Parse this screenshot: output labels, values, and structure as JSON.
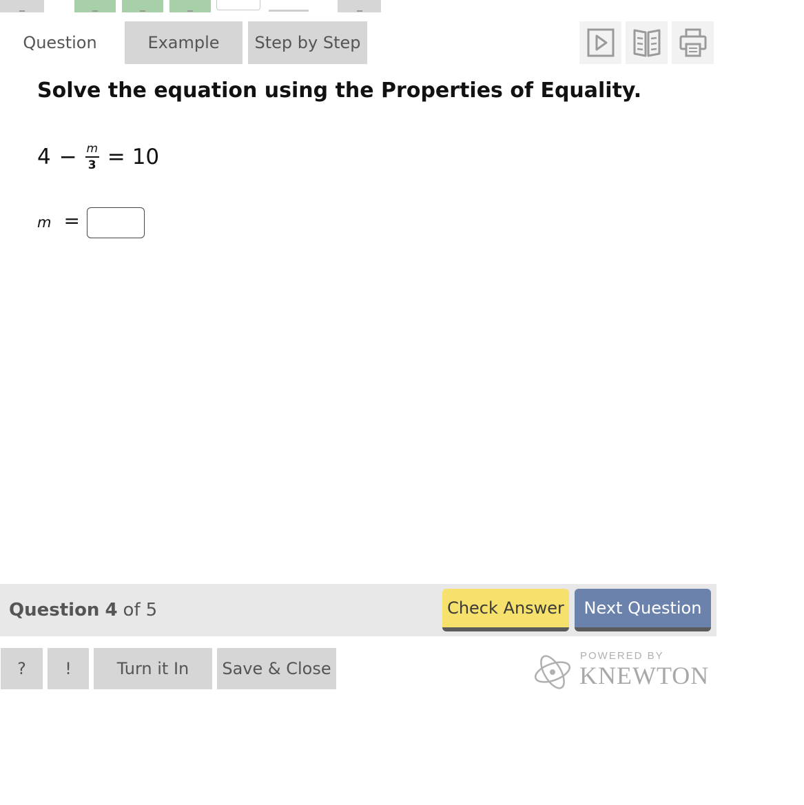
{
  "tabs": {
    "question": "Question",
    "example": "Example",
    "step_by_step": "Step by Step"
  },
  "tools": [
    "play-icon",
    "book-icon",
    "print-icon"
  ],
  "problem": {
    "instruction": "Solve the equation using the Properties of Equality.",
    "equation": {
      "lhs_constant": "4",
      "minus": "−",
      "frac_numerator": "m",
      "frac_denominator": "3",
      "equals": "=",
      "rhs": "10"
    },
    "answer": {
      "variable": "m",
      "equals": "=",
      "value": "",
      "placeholder": ""
    }
  },
  "status": {
    "question_word": "Question",
    "current": "4",
    "of_word": "of",
    "total": "5"
  },
  "buttons": {
    "check_answer": "Check Answer",
    "next_question": "Next Question",
    "help": "?",
    "report": "!",
    "turn_in": "Turn it In",
    "save_close": "Save & Close"
  },
  "branding": {
    "powered_by": "POWERED BY",
    "name": "KNEWTON"
  },
  "colors": {
    "check_answer_bg": "#f5e16b",
    "next_question_bg": "#6b82ac",
    "tab_bg": "#d6d6d6",
    "nav_green": "#a8d0a8"
  }
}
